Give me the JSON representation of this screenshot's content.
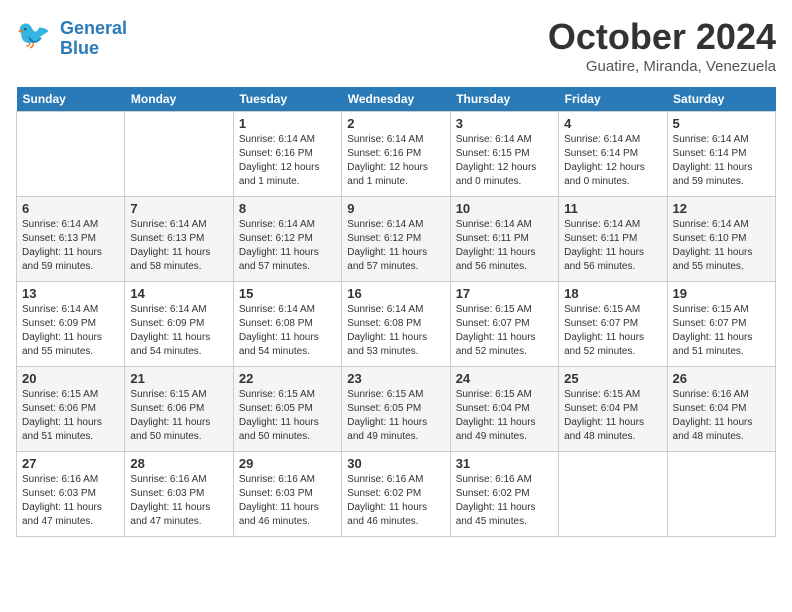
{
  "header": {
    "logo_line1": "General",
    "logo_line2": "Blue",
    "month": "October 2024",
    "location": "Guatire, Miranda, Venezuela"
  },
  "days_of_week": [
    "Sunday",
    "Monday",
    "Tuesday",
    "Wednesday",
    "Thursday",
    "Friday",
    "Saturday"
  ],
  "weeks": [
    [
      {
        "day": "",
        "info": ""
      },
      {
        "day": "",
        "info": ""
      },
      {
        "day": "1",
        "info": "Sunrise: 6:14 AM\nSunset: 6:16 PM\nDaylight: 12 hours\nand 1 minute."
      },
      {
        "day": "2",
        "info": "Sunrise: 6:14 AM\nSunset: 6:16 PM\nDaylight: 12 hours\nand 1 minute."
      },
      {
        "day": "3",
        "info": "Sunrise: 6:14 AM\nSunset: 6:15 PM\nDaylight: 12 hours\nand 0 minutes."
      },
      {
        "day": "4",
        "info": "Sunrise: 6:14 AM\nSunset: 6:14 PM\nDaylight: 12 hours\nand 0 minutes."
      },
      {
        "day": "5",
        "info": "Sunrise: 6:14 AM\nSunset: 6:14 PM\nDaylight: 11 hours\nand 59 minutes."
      }
    ],
    [
      {
        "day": "6",
        "info": "Sunrise: 6:14 AM\nSunset: 6:13 PM\nDaylight: 11 hours\nand 59 minutes."
      },
      {
        "day": "7",
        "info": "Sunrise: 6:14 AM\nSunset: 6:13 PM\nDaylight: 11 hours\nand 58 minutes."
      },
      {
        "day": "8",
        "info": "Sunrise: 6:14 AM\nSunset: 6:12 PM\nDaylight: 11 hours\nand 57 minutes."
      },
      {
        "day": "9",
        "info": "Sunrise: 6:14 AM\nSunset: 6:12 PM\nDaylight: 11 hours\nand 57 minutes."
      },
      {
        "day": "10",
        "info": "Sunrise: 6:14 AM\nSunset: 6:11 PM\nDaylight: 11 hours\nand 56 minutes."
      },
      {
        "day": "11",
        "info": "Sunrise: 6:14 AM\nSunset: 6:11 PM\nDaylight: 11 hours\nand 56 minutes."
      },
      {
        "day": "12",
        "info": "Sunrise: 6:14 AM\nSunset: 6:10 PM\nDaylight: 11 hours\nand 55 minutes."
      }
    ],
    [
      {
        "day": "13",
        "info": "Sunrise: 6:14 AM\nSunset: 6:09 PM\nDaylight: 11 hours\nand 55 minutes."
      },
      {
        "day": "14",
        "info": "Sunrise: 6:14 AM\nSunset: 6:09 PM\nDaylight: 11 hours\nand 54 minutes."
      },
      {
        "day": "15",
        "info": "Sunrise: 6:14 AM\nSunset: 6:08 PM\nDaylight: 11 hours\nand 54 minutes."
      },
      {
        "day": "16",
        "info": "Sunrise: 6:14 AM\nSunset: 6:08 PM\nDaylight: 11 hours\nand 53 minutes."
      },
      {
        "day": "17",
        "info": "Sunrise: 6:15 AM\nSunset: 6:07 PM\nDaylight: 11 hours\nand 52 minutes."
      },
      {
        "day": "18",
        "info": "Sunrise: 6:15 AM\nSunset: 6:07 PM\nDaylight: 11 hours\nand 52 minutes."
      },
      {
        "day": "19",
        "info": "Sunrise: 6:15 AM\nSunset: 6:07 PM\nDaylight: 11 hours\nand 51 minutes."
      }
    ],
    [
      {
        "day": "20",
        "info": "Sunrise: 6:15 AM\nSunset: 6:06 PM\nDaylight: 11 hours\nand 51 minutes."
      },
      {
        "day": "21",
        "info": "Sunrise: 6:15 AM\nSunset: 6:06 PM\nDaylight: 11 hours\nand 50 minutes."
      },
      {
        "day": "22",
        "info": "Sunrise: 6:15 AM\nSunset: 6:05 PM\nDaylight: 11 hours\nand 50 minutes."
      },
      {
        "day": "23",
        "info": "Sunrise: 6:15 AM\nSunset: 6:05 PM\nDaylight: 11 hours\nand 49 minutes."
      },
      {
        "day": "24",
        "info": "Sunrise: 6:15 AM\nSunset: 6:04 PM\nDaylight: 11 hours\nand 49 minutes."
      },
      {
        "day": "25",
        "info": "Sunrise: 6:15 AM\nSunset: 6:04 PM\nDaylight: 11 hours\nand 48 minutes."
      },
      {
        "day": "26",
        "info": "Sunrise: 6:16 AM\nSunset: 6:04 PM\nDaylight: 11 hours\nand 48 minutes."
      }
    ],
    [
      {
        "day": "27",
        "info": "Sunrise: 6:16 AM\nSunset: 6:03 PM\nDaylight: 11 hours\nand 47 minutes."
      },
      {
        "day": "28",
        "info": "Sunrise: 6:16 AM\nSunset: 6:03 PM\nDaylight: 11 hours\nand 47 minutes."
      },
      {
        "day": "29",
        "info": "Sunrise: 6:16 AM\nSunset: 6:03 PM\nDaylight: 11 hours\nand 46 minutes."
      },
      {
        "day": "30",
        "info": "Sunrise: 6:16 AM\nSunset: 6:02 PM\nDaylight: 11 hours\nand 46 minutes."
      },
      {
        "day": "31",
        "info": "Sunrise: 6:16 AM\nSunset: 6:02 PM\nDaylight: 11 hours\nand 45 minutes."
      },
      {
        "day": "",
        "info": ""
      },
      {
        "day": "",
        "info": ""
      }
    ]
  ]
}
